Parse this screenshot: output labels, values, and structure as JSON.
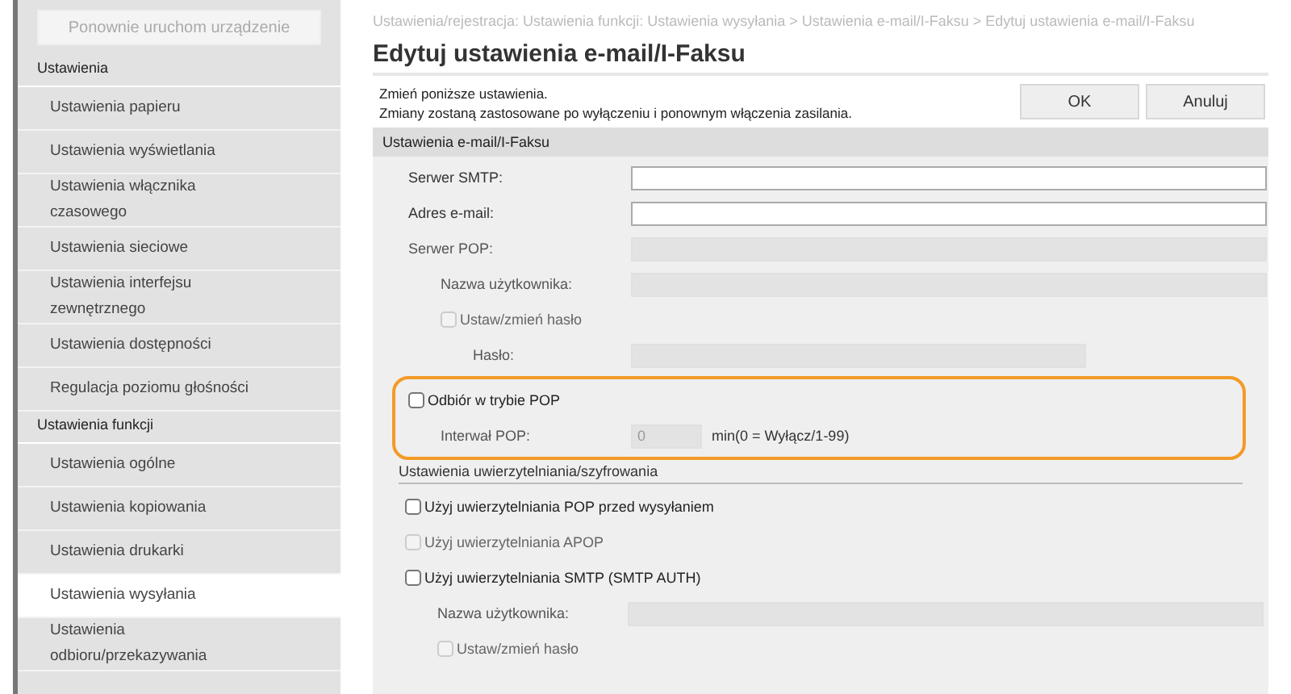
{
  "sidebar": {
    "restart_button": {
      "label": "Ponownie uruchom urządzenie",
      "disabled": true
    },
    "items": [
      {
        "kind": "heading",
        "label": "Ustawienia"
      },
      {
        "kind": "item",
        "label": "Ustawienia papieru",
        "selected": false
      },
      {
        "kind": "item",
        "label": "Ustawienia wyświetlania",
        "selected": false
      },
      {
        "kind": "item",
        "label": "Ustawienia włącznika czasowego",
        "selected": false
      },
      {
        "kind": "item",
        "label": "Ustawienia sieciowe",
        "selected": false
      },
      {
        "kind": "item",
        "label": "Ustawienia interfejsu zewnętrznego",
        "selected": false
      },
      {
        "kind": "item",
        "label": "Ustawienia dostępności",
        "selected": false
      },
      {
        "kind": "item",
        "label": "Regulacja poziomu głośności",
        "selected": false
      },
      {
        "kind": "heading",
        "label": "Ustawienia funkcji"
      },
      {
        "kind": "item",
        "label": "Ustawienia ogólne",
        "selected": false
      },
      {
        "kind": "item",
        "label": "Ustawienia kopiowania",
        "selected": false
      },
      {
        "kind": "item",
        "label": "Ustawienia drukarki",
        "selected": false
      },
      {
        "kind": "item",
        "label": "Ustawienia wysyłania",
        "selected": true
      },
      {
        "kind": "item",
        "label": "Ustawienia odbioru/przekazywania",
        "selected": false
      }
    ]
  },
  "breadcrumb": "Ustawienia/rejestracja: Ustawienia funkcji: Ustawienia wysyłania > Ustawienia e-mail/I-Faksu > Edytuj ustawienia e-mail/I-Faksu",
  "title": "Edytuj ustawienia e-mail/I-Faksu",
  "instructions": [
    "Zmień poniższe ustawienia.",
    "Zmiany zostaną zastosowane po wyłączeniu i ponownym włączenia zasilania."
  ],
  "buttons": [
    "OK",
    "Anuluj"
  ],
  "section": {
    "title": "Ustawienia e-mail/I-Faksu",
    "rows": [
      {
        "kind": "field",
        "label": "Serwer SMTP:",
        "disabled": false
      },
      {
        "kind": "field",
        "label": "Adres e-mail:",
        "disabled": false
      },
      {
        "kind": "field",
        "label": "Serwer POP:",
        "disabled": true,
        "children": [
          {
            "kind": "field",
            "label": "Nazwa użytkownika:",
            "disabled": true
          },
          {
            "kind": "checkbox",
            "label": "Ustaw/zmień hasło",
            "checked": false,
            "disabled": true,
            "children": [
              {
                "kind": "short-field",
                "label": "Hasło:",
                "disabled": true
              }
            ]
          }
        ]
      }
    ],
    "highlight": {
      "rows": [
        {
          "kind": "checkbox",
          "label": "Odbiór w trybie POP",
          "checked": false,
          "disabled": false,
          "children": [
            {
              "kind": "number",
              "label": "Interwał POP:",
              "value": "0",
              "unit": "min(0 = Wyłącz/1-99)",
              "disabled": true
            }
          ]
        }
      ]
    },
    "subsection": {
      "title": "Ustawienia uwierzytelniania/szyfrowania",
      "rows": [
        {
          "kind": "checkbox",
          "label": "Użyj uwierzytelniania POP przed wysyłaniem",
          "checked": false,
          "disabled": false
        },
        {
          "kind": "checkbox",
          "label": "Użyj uwierzytelniania APOP",
          "checked": false,
          "disabled": true
        },
        {
          "kind": "checkbox",
          "label": "Użyj uwierzytelniania SMTP (SMTP AUTH)",
          "checked": false,
          "disabled": false,
          "children": [
            {
              "kind": "field",
              "label": "Nazwa użytkownika:",
              "disabled": true
            },
            {
              "kind": "checkbox",
              "label": "Ustaw/zmień hasło",
              "checked": false,
              "disabled": true
            }
          ]
        }
      ]
    }
  }
}
